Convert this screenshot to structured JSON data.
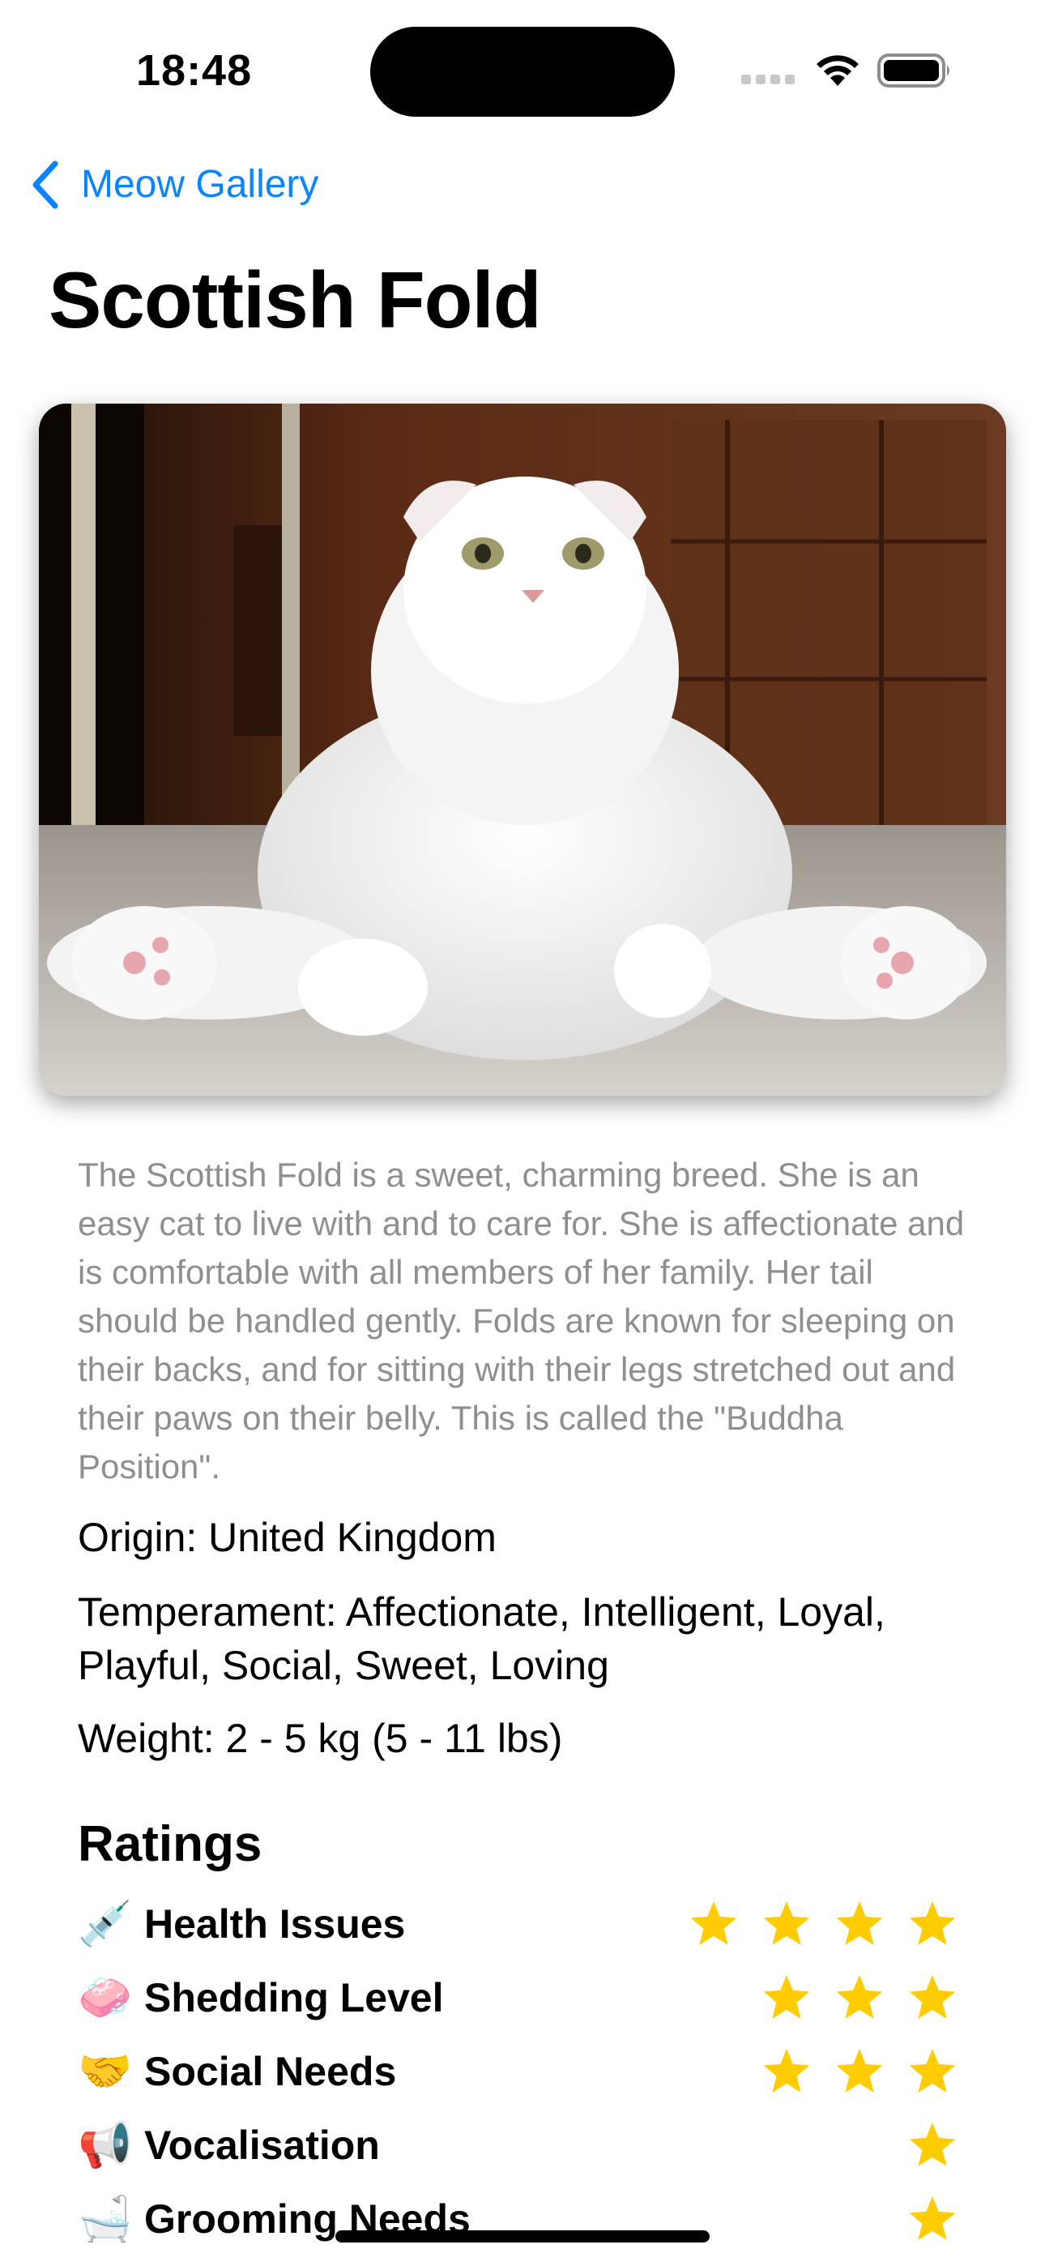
{
  "status_bar": {
    "time": "18:48"
  },
  "nav": {
    "back_label": "Meow Gallery"
  },
  "page": {
    "title": "Scottish Fold"
  },
  "breed": {
    "description": "The Scottish Fold is a sweet, charming breed. She is an easy cat to live with and to care for. She is affectionate and is comfortable with all members of her family. Her tail should be handled gently. Folds are known for sleeping on their backs, and for sitting with their legs stretched out and their paws on their belly. This is called the \"Buddha Position\".",
    "origin": "Origin: United Kingdom",
    "temperament": "Temperament: Affectionate, Intelligent, Loyal, Playful, Social, Sweet, Loving",
    "weight": "Weight: 2 - 5 kg (5 - 11 lbs)"
  },
  "ratings": {
    "title": "Ratings",
    "items": [
      {
        "emoji": "💉",
        "label": "Health Issues",
        "stars": 4
      },
      {
        "emoji": "🧼",
        "label": "Shedding Level",
        "stars": 3
      },
      {
        "emoji": "🤝",
        "label": "Social Needs",
        "stars": 3
      },
      {
        "emoji": "📢",
        "label": "Vocalisation",
        "stars": 1
      },
      {
        "emoji": "🛁",
        "label": "Grooming Needs",
        "stars": 1
      }
    ]
  },
  "colors": {
    "accent": "#0a84ff",
    "star": "#ffcc00",
    "secondary_text": "#8e8e93"
  },
  "icons": {
    "back": "chevron-left-icon",
    "signal": "cellular-signal-icon",
    "wifi": "wifi-icon",
    "battery": "battery-icon",
    "star": "star-icon"
  }
}
